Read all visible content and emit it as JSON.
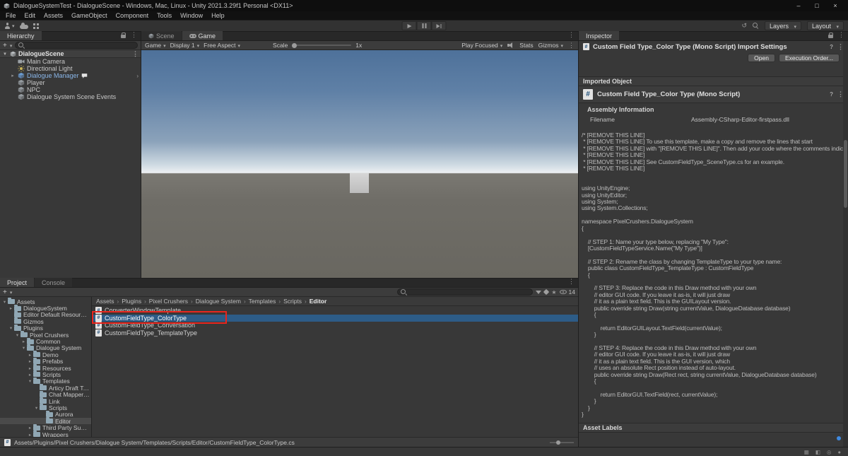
{
  "titlebar": {
    "title": "DialogueSystemTest - DialogueScene - Windows, Mac, Linux - Unity 2021.3.29f1 Personal <DX11>"
  },
  "menubar": {
    "items": [
      "File",
      "Edit",
      "Assets",
      "GameObject",
      "Component",
      "Tools",
      "Window",
      "Help"
    ]
  },
  "toolbar": {
    "layers": "Layers",
    "layout": "Layout"
  },
  "hierarchy": {
    "tab": "Hierarchy",
    "scene": "DialogueScene",
    "items": [
      "Main Camera",
      "Directional Light",
      "Dialogue Manager",
      "Player",
      "NPC",
      "Dialogue System Scene Events"
    ]
  },
  "game": {
    "tab_scene": "Scene",
    "tab_game": "Game",
    "tb": {
      "mode": "Game",
      "display": "Display 1",
      "aspect": "Free Aspect",
      "scale_label": "Scale",
      "scale_value": "1x",
      "play_focused": "Play Focused",
      "stats": "Stats",
      "gizmos": "Gizmos"
    }
  },
  "inspector": {
    "tab": "Inspector",
    "title": "Custom Field Type_Color Type (Mono Script) Import Settings",
    "open": "Open",
    "execution_order": "Execution Order...",
    "imported_object": "Imported Object",
    "object_title": "Custom Field Type_Color Type (Mono Script)",
    "assembly_information": "Assembly Information",
    "filename_label": "Filename",
    "filename_value": "Assembly-CSharp-Editor-firstpass.dll",
    "asset_labels": "Asset Labels",
    "code": "/* [REMOVE THIS LINE]\n * [REMOVE THIS LINE] To use this template, make a copy and remove the lines that start\n * [REMOVE THIS LINE] with \"[REMOVE THIS LINE]\". Then add your code where the comments indicate.\n * [REMOVE THIS LINE]\n * [REMOVE THIS LINE] See CustomFieldType_SceneType.cs for an example.\n * [REMOVE THIS LINE]\n\n\nusing UnityEngine;\nusing UnityEditor;\nusing System;\nusing System.Collections;\n\nnamespace PixelCrushers.DialogueSystem\n{\n\n    // STEP 1: Name your type below, replacing \"My Type\":\n    [CustomFieldTypeService.Name(\"My Type\")]\n\n    // STEP 2: Rename the class by changing TemplateType to your type name:\n    public class CustomFieldType_TemplateType : CustomFieldType\n    {\n\n        // STEP 3: Replace the code in this Draw method with your own\n        // editor GUI code. If you leave it as-is, it will just draw\n        // it as a plain text field. This is the GUILayout version.\n        public override string Draw(string currentValue, DialogueDatabase database)\n        {\n\n            return EditorGUILayout.TextField(currentValue);\n        }\n\n        // STEP 4: Replace the code in this Draw method with your own\n        // editor GUI code. If you leave it as-is, it will just draw\n        // it as a plain text field. This is the GUI version, which\n        // uses an absolute Rect position instead of auto-layout.\n        public override string Draw(Rect rect, string currentValue, DialogueDatabase database)\n        {\n\n            return EditorGUI.TextField(rect, currentValue);\n        }\n    }\n}"
  },
  "project": {
    "tab_project": "Project",
    "tab_console": "Console",
    "count": "14",
    "crumbs": [
      "Assets",
      "Plugins",
      "Pixel Crushers",
      "Dialogue System",
      "Templates",
      "Scripts",
      "Editor"
    ],
    "tree": [
      "Assets",
      "DialogueSystem",
      "Editor Default Resources",
      "Gizmos",
      "Plugins",
      "Pixel Crushers",
      "Common",
      "Dialogue System",
      "Demo",
      "Prefabs",
      "Resources",
      "Scripts",
      "Templates",
      "Articy Draft Templates",
      "Chat Mapper Templates",
      "Link",
      "Scripts",
      "Aurora",
      "Editor",
      "Third Party Support",
      "Wrappers"
    ],
    "files": [
      "ConverterWindowTemplate",
      "CustomFieldType_ColorType",
      "CustomFieldType_Conversation",
      "CustomFieldType_TemplateType"
    ],
    "path": "Assets/Plugins/Pixel Crushers/Dialogue System/Templates/Scripts/Editor/CustomFieldType_ColorType.cs"
  },
  "annotation": {
    "highlight_color": "#e8251d"
  }
}
